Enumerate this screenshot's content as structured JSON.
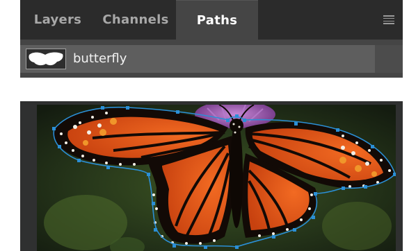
{
  "panel": {
    "tabs": [
      {
        "label": "Layers",
        "active": false
      },
      {
        "label": "Channels",
        "active": false
      },
      {
        "label": "Paths",
        "active": true
      }
    ],
    "menu_icon": "hamburger-menu-icon",
    "paths": [
      {
        "name": "butterfly",
        "thumbnail": "butterfly-silhouette"
      }
    ]
  },
  "canvas": {
    "subject": "monarch butterfly photo with selected path outline",
    "path_color": "#2b8fd6",
    "wing_color": "#e4511a",
    "background_color": "#2b3a1c"
  }
}
